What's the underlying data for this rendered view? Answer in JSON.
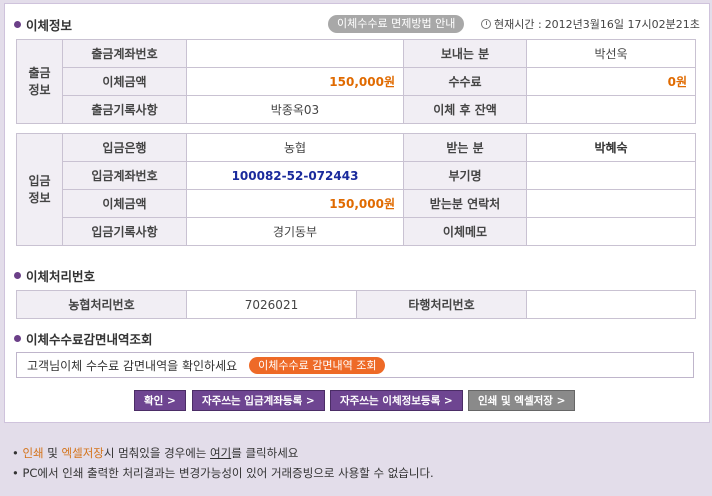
{
  "header": {
    "title": "이체정보",
    "fee_guide_button": "이체수수료 면제방법 안내",
    "time_label": "현재시간 :",
    "time_value": "2012년3월16일 17시02분21초"
  },
  "withdrawal": {
    "side_label": "출금\n정보",
    "rows": [
      {
        "l1": "출금계좌번호",
        "v1": "",
        "l2": "보내는 분",
        "v2": "박선욱"
      },
      {
        "l1": "이체금액",
        "v1": "150,000원",
        "l2": "수수료",
        "v2": "0원"
      },
      {
        "l1": "출금기록사항",
        "v1": "박종옥03",
        "l2": "이체 후 잔액",
        "v2": ""
      }
    ]
  },
  "deposit": {
    "side_label": "입금\n정보",
    "rows": [
      {
        "l1": "입금은행",
        "v1": "농협",
        "l2": "받는 분",
        "v2": "박혜숙"
      },
      {
        "l1": "입금계좌번호",
        "v1": "100082-52-072443",
        "l2": "부기명",
        "v2": ""
      },
      {
        "l1": "이체금액",
        "v1": "150,000원",
        "l2": "받는분 연락처",
        "v2": ""
      },
      {
        "l1": "입금기록사항",
        "v1": "경기동부",
        "l2": "이체메모",
        "v2": ""
      }
    ]
  },
  "processing": {
    "title": "이체처리번호",
    "l1": "농협처리번호",
    "v1": "7026021",
    "l2": "타행처리번호",
    "v2": ""
  },
  "fee_inquiry": {
    "title": "이체수수료감면내역조회",
    "text": "고객님이체 수수료 감면내역을 확인하세요",
    "button": "이체수수료 감면내역 조회"
  },
  "buttons": {
    "confirm": "확인 >",
    "reg_deposit": "자주쓰는 입금계좌등록 >",
    "reg_transfer": "자주쓰는 이체정보등록 >",
    "print_excel": "인쇄 및 엑셀저장 >"
  },
  "notes": {
    "n1_hl1": "인쇄",
    "n1_mid": " 및 ",
    "n1_hl2": "엑셀저장",
    "n1_rest": "시 멈춰있을 경우에는 ",
    "n1_link": "여기",
    "n1_end": "를 클릭하세요",
    "n2": "PC에서 인쇄 출력한 처리결과는 변경가능성이 있어 거래증빙으로 사용할 수 없습니다."
  },
  "colors": {
    "accent": "#6e4591",
    "amount": "#e06a00",
    "account": "#1a2a9c",
    "page_bg": "#e3ddea"
  }
}
